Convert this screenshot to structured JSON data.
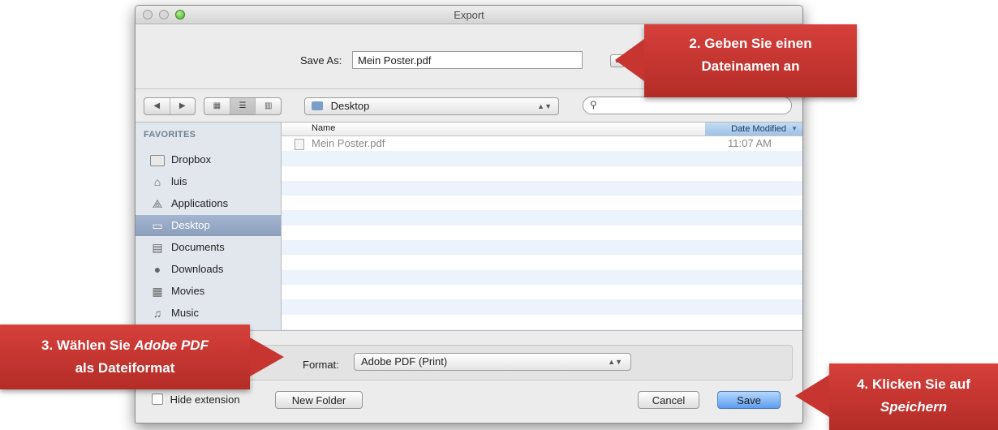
{
  "window": {
    "title": "Export"
  },
  "save_as": {
    "label": "Save As:",
    "value": "Mein Poster.pdf"
  },
  "location": {
    "value": "Desktop"
  },
  "sidebar": {
    "header": "FAVORITES",
    "items": [
      {
        "label": "Dropbox",
        "icon": "folder-icon"
      },
      {
        "label": "luis",
        "icon": "home-icon"
      },
      {
        "label": "Applications",
        "icon": "applications-icon"
      },
      {
        "label": "Desktop",
        "icon": "desktop-icon",
        "selected": true
      },
      {
        "label": "Documents",
        "icon": "documents-icon"
      },
      {
        "label": "Downloads",
        "icon": "downloads-icon"
      },
      {
        "label": "Movies",
        "icon": "movies-icon"
      },
      {
        "label": "Music",
        "icon": "music-icon"
      }
    ]
  },
  "file_list": {
    "columns": {
      "name": "Name",
      "date": "Date Modified"
    },
    "files": [
      {
        "name": "Mein Poster.pdf",
        "date": "11:07 AM"
      }
    ]
  },
  "format": {
    "label": "Format:",
    "value": "Adobe PDF (Print)"
  },
  "options": {
    "hide_extension": "Hide extension"
  },
  "buttons": {
    "new_folder": "New Folder",
    "cancel": "Cancel",
    "save": "Save"
  },
  "callouts": {
    "step2_line1": "2. Geben Sie einen",
    "step2_line2": "Dateinamen an",
    "step3_line1_a": "3. Wählen Sie ",
    "step3_line1_em": "Adobe PDF",
    "step3_line2": "als Dateiformat",
    "step4_line1": "4. Klicken Sie auf",
    "step4_line2": "Speichern"
  },
  "colors": {
    "callout": "#c6352f",
    "selection": "#8c9fbb",
    "save_button": "#5c9df0"
  }
}
